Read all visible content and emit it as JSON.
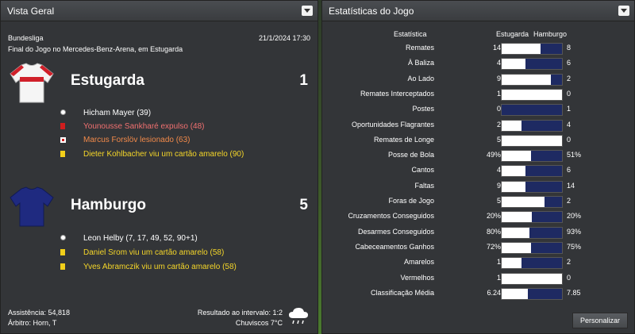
{
  "left_panel": {
    "title": "Vista Geral",
    "competition": "Bundesliga",
    "datetime": "21/1/2024 17:30",
    "result_line": "Final do Jogo no Mercedes-Benz-Arena, em Estugarda",
    "home": {
      "name": "Estugarda",
      "score": "1",
      "kit_colors": {
        "body": "#f5f5f5",
        "stripe": "#d0202a"
      },
      "events": [
        {
          "icon": "goal-icon",
          "text": "Hicham Mayer (39)",
          "color": "#ffffff"
        },
        {
          "icon": "red-card-icon",
          "text": "Younousse Sankharé expulso (48)",
          "color": "#f07070"
        },
        {
          "icon": "injury-icon",
          "text": "Marcus Forslöv lesionado (63)",
          "color": "#f28a4a"
        },
        {
          "icon": "yellow-card-icon",
          "text": "Dieter Kohlbacher viu um cartão amarelo (90)",
          "color": "#f5d629"
        }
      ]
    },
    "away": {
      "name": "Hamburgo",
      "score": "5",
      "kit_colors": {
        "body": "#1f2a80"
      },
      "events": [
        {
          "icon": "goal-icon",
          "text": "Leon Helby (7, 17, 49, 52, 90+1)",
          "color": "#ffffff"
        },
        {
          "icon": "yellow-card-icon",
          "text": "Daniel Srom viu um cartão amarelo (58)",
          "color": "#f5d629"
        },
        {
          "icon": "yellow-card-icon",
          "text": "Yves Abramczik viu um cartão amarelo (58)",
          "color": "#f5d629"
        }
      ]
    },
    "footer": {
      "attendance": "Assistência: 54,818",
      "referee": "Árbitro: Horn, T",
      "halftime": "Resultado ao intervalo: 1:2",
      "weather": "Chuviscos 7°C",
      "weather_icon": "cloud-rain-icon"
    }
  },
  "right_panel": {
    "title": "Estatísticas do Jogo",
    "headers": {
      "stat": "Estatística",
      "home": "Estugarda",
      "away": "Hamburgo"
    },
    "rows": [
      {
        "label": "Remates",
        "home": "14",
        "away": "8",
        "home_share": 0.64
      },
      {
        "label": "À Baliza",
        "home": "4",
        "away": "6",
        "home_share": 0.4
      },
      {
        "label": "Ao Lado",
        "home": "9",
        "away": "2",
        "home_share": 0.82
      },
      {
        "label": "Remates Interceptados",
        "home": "1",
        "away": "0",
        "home_share": 1.0
      },
      {
        "label": "Postes",
        "home": "0",
        "away": "1",
        "home_share": 0.0
      },
      {
        "label": "Oportunidades Flagrantes",
        "home": "2",
        "away": "4",
        "home_share": 0.33
      },
      {
        "label": "Remates de Longe",
        "home": "5",
        "away": "0",
        "home_share": 1.0
      },
      {
        "label": "Posse de Bola",
        "home": "49%",
        "away": "51%",
        "home_share": 0.49
      },
      {
        "label": "Cantos",
        "home": "4",
        "away": "6",
        "home_share": 0.4
      },
      {
        "label": "Faltas",
        "home": "9",
        "away": "14",
        "home_share": 0.39
      },
      {
        "label": "Foras de Jogo",
        "home": "5",
        "away": "2",
        "home_share": 0.71
      },
      {
        "label": "Cruzamentos Conseguidos",
        "home": "20%",
        "away": "20%",
        "home_share": 0.5
      },
      {
        "label": "Desarmes Conseguidos",
        "home": "80%",
        "away": "93%",
        "home_share": 0.46
      },
      {
        "label": "Cabeceamentos Ganhos",
        "home": "72%",
        "away": "75%",
        "home_share": 0.49
      },
      {
        "label": "Amarelos",
        "home": "1",
        "away": "2",
        "home_share": 0.33
      },
      {
        "label": "Vermelhos",
        "home": "1",
        "away": "0",
        "home_share": 1.0
      },
      {
        "label": "Classificação Média",
        "home": "6.24",
        "away": "7.85",
        "home_share": 0.44
      }
    ],
    "customize_label": "Personalizar",
    "colors": {
      "home_bar": "#ffffff",
      "away_bar": "#1e2a62"
    }
  }
}
